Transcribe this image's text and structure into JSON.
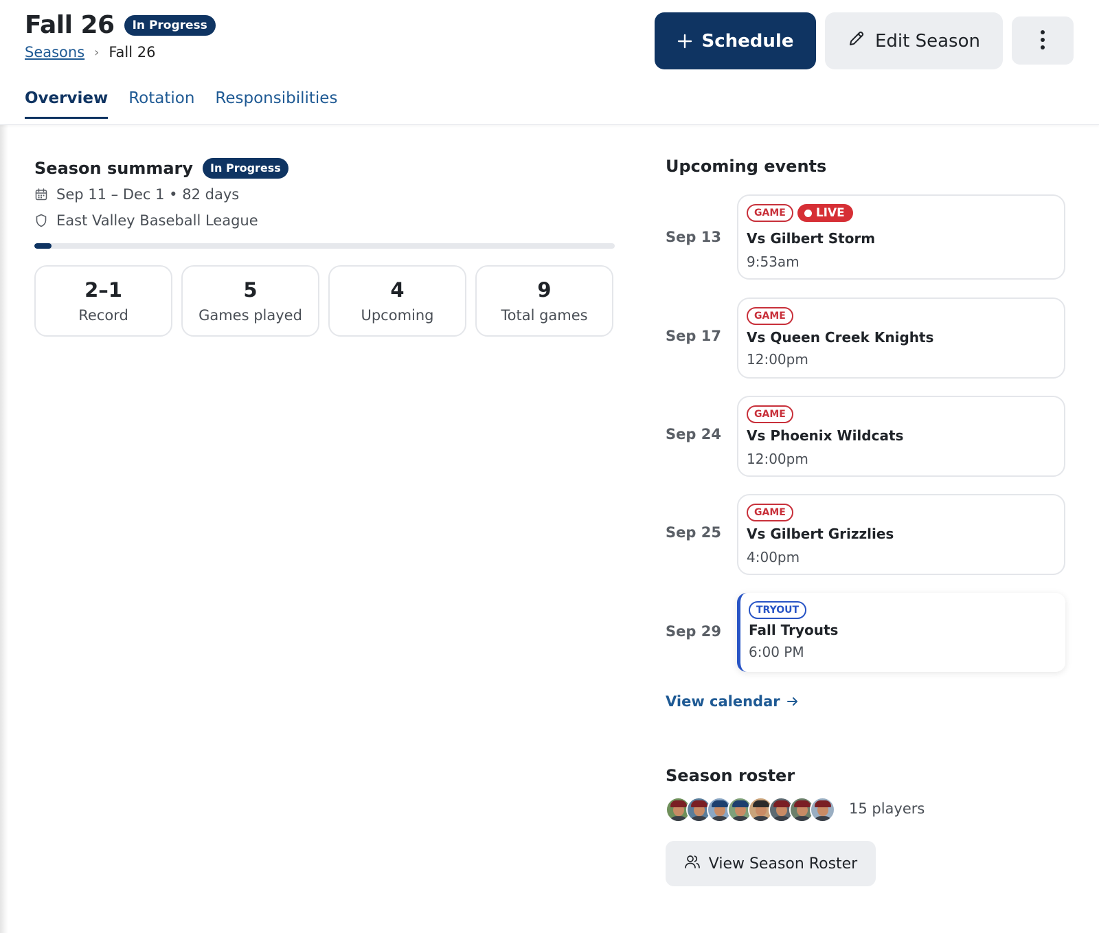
{
  "header": {
    "title": "Fall 26",
    "status": "In Progress",
    "breadcrumb": {
      "parent": "Seasons",
      "separator": "›",
      "current": "Fall 26"
    },
    "actions": {
      "schedule_label": "Schedule",
      "edit_label": "Edit Season"
    },
    "tabs": [
      {
        "label": "Overview",
        "active": true
      },
      {
        "label": "Rotation",
        "active": false
      },
      {
        "label": "Responsibilities",
        "active": false
      }
    ]
  },
  "summary": {
    "heading": "Season summary",
    "status": "In Progress",
    "dates": "Sep 11 – Dec 1 • 82 days",
    "league": "East Valley Baseball League",
    "progress_fraction": 0.03,
    "stats": [
      {
        "value": "2–1",
        "label": "Record"
      },
      {
        "value": "5",
        "label": "Games played"
      },
      {
        "value": "4",
        "label": "Upcoming"
      },
      {
        "value": "9",
        "label": "Total games"
      }
    ]
  },
  "upcoming": {
    "heading": "Upcoming events",
    "events": [
      {
        "date": "Sep 13",
        "type": "GAME",
        "live": "LIVE",
        "title": "Vs Gilbert Storm",
        "time": "9:53am"
      },
      {
        "date": "Sep 17",
        "type": "GAME",
        "title": "Vs Queen Creek Knights",
        "time": "12:00pm"
      },
      {
        "date": "Sep 24",
        "type": "GAME",
        "title": "Vs Phoenix Wildcats",
        "time": "12:00pm"
      },
      {
        "date": "Sep 25",
        "type": "GAME",
        "title": "Vs Gilbert Grizzlies",
        "time": "4:00pm"
      },
      {
        "date": "Sep 29",
        "type": "TRYOUT",
        "title": "Fall Tryouts",
        "time": "6:00 PM"
      }
    ],
    "view_calendar": "View calendar"
  },
  "roster": {
    "heading": "Season roster",
    "players": "15 players",
    "button_label": "View Season Roster"
  },
  "colors": {
    "brand_navy": "#0f3462",
    "link_blue": "#1f5a94",
    "game_red": "#c8303a",
    "live_red": "#d62f35",
    "tryout_blue": "#2854c5"
  },
  "icons": {
    "schedule": "plus-icon",
    "edit": "pencil-icon",
    "more": "kebab-menu-icon",
    "dates": "calendar-icon",
    "league": "shield-icon",
    "calendar_link": "arrow-right-icon",
    "roster": "users-icon"
  }
}
